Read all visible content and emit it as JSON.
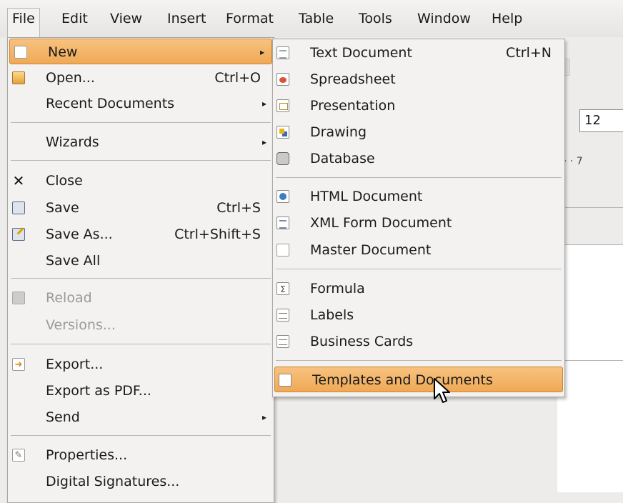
{
  "menubar": {
    "items": [
      {
        "label": "File",
        "active": true
      },
      {
        "label": "Edit"
      },
      {
        "label": "View"
      },
      {
        "label": "Insert"
      },
      {
        "label": "Format"
      },
      {
        "label": "Table"
      },
      {
        "label": "Tools"
      },
      {
        "label": "Window"
      },
      {
        "label": "Help"
      }
    ]
  },
  "document": {
    "font_size_value": "12",
    "ruler_text": "· · · 7"
  },
  "file_menu": {
    "items": [
      {
        "label": "New",
        "icon": "new-document-icon",
        "submenu": true,
        "highlighted": true
      },
      {
        "label": "Open...",
        "accel": "Ctrl+O",
        "icon": "open-folder-icon"
      },
      {
        "label": "Recent Documents",
        "submenu": true
      },
      {
        "label": "Wizards",
        "submenu": true
      },
      {
        "label": "Close",
        "icon": "close-icon"
      },
      {
        "label": "Save",
        "accel": "Ctrl+S",
        "icon": "save-icon"
      },
      {
        "label": "Save As...",
        "accel": "Ctrl+Shift+S",
        "icon": "save-as-icon"
      },
      {
        "label": "Save All"
      },
      {
        "label": "Reload",
        "icon": "reload-icon",
        "disabled": true
      },
      {
        "label": "Versions...",
        "disabled": true
      },
      {
        "label": "Export...",
        "icon": "export-icon"
      },
      {
        "label": "Export as PDF..."
      },
      {
        "label": "Send",
        "submenu": true
      },
      {
        "label": "Properties...",
        "icon": "properties-icon"
      },
      {
        "label": "Digital Signatures..."
      }
    ]
  },
  "new_menu": {
    "items": [
      {
        "label": "Text Document",
        "accel": "Ctrl+N",
        "icon": "text-document-icon"
      },
      {
        "label": "Spreadsheet",
        "icon": "spreadsheet-icon"
      },
      {
        "label": "Presentation",
        "icon": "presentation-icon"
      },
      {
        "label": "Drawing",
        "icon": "drawing-icon"
      },
      {
        "label": "Database",
        "icon": "database-icon"
      },
      {
        "label": "HTML Document",
        "icon": "html-document-icon"
      },
      {
        "label": "XML Form Document",
        "icon": "xml-form-icon"
      },
      {
        "label": "Master Document",
        "icon": "master-document-icon"
      },
      {
        "label": "Formula",
        "icon": "formula-icon"
      },
      {
        "label": "Labels",
        "icon": "labels-icon"
      },
      {
        "label": "Business Cards",
        "icon": "business-cards-icon"
      },
      {
        "label": "Templates and Documents",
        "icon": "templates-icon",
        "highlighted": true
      }
    ]
  },
  "colors": {
    "highlight": "#f0a956",
    "menu_background": "#f4f2f0",
    "window_background": "#edeceb"
  }
}
